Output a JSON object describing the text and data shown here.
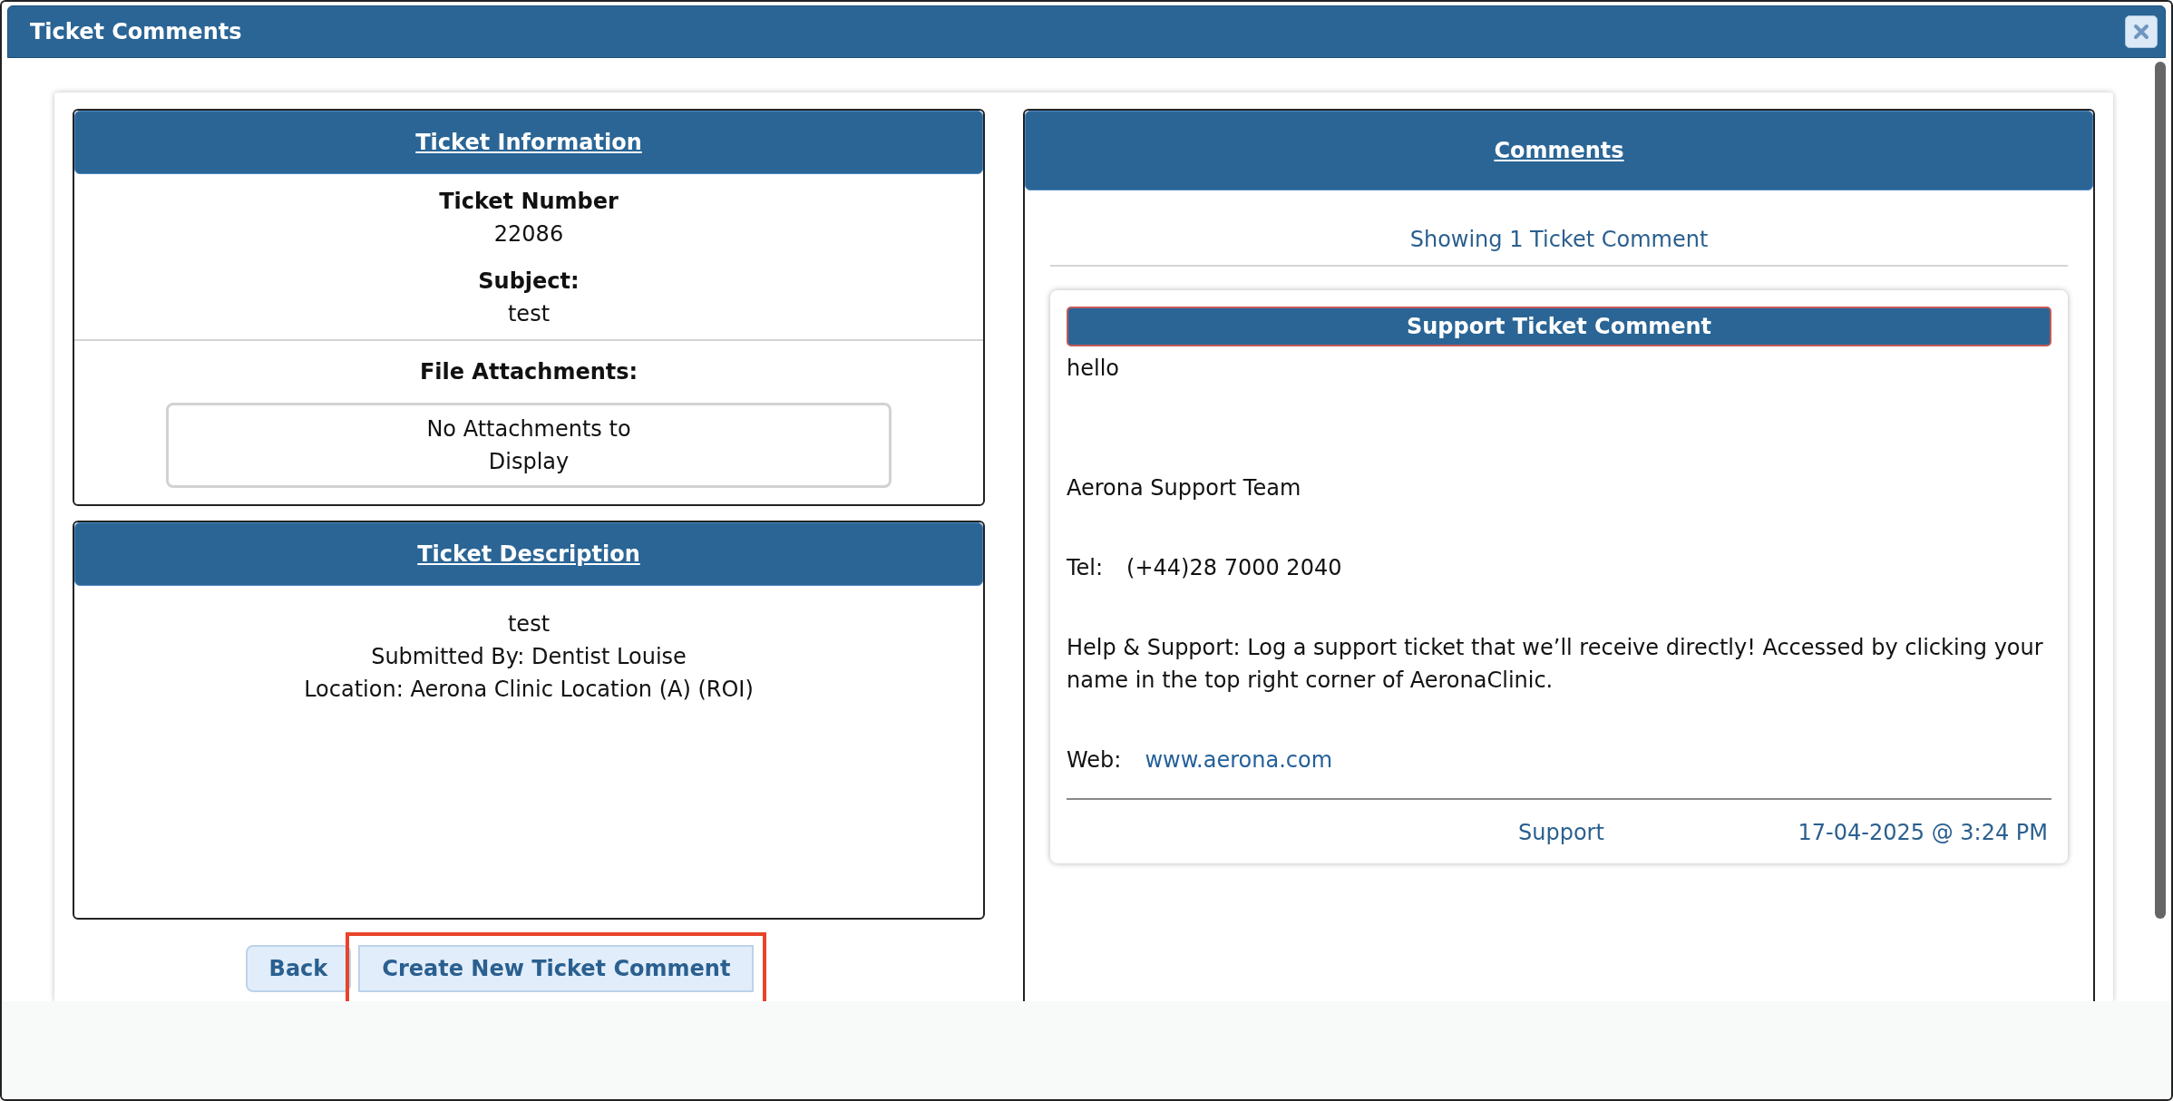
{
  "window": {
    "title": "Ticket Comments"
  },
  "ticket_information": {
    "heading": "Ticket Information",
    "fields": [
      {
        "label": "Ticket Number",
        "value": "22086"
      },
      {
        "label": "Subject:",
        "value": "test"
      }
    ],
    "attachments_label": "File Attachments:",
    "attachments_empty": "No Attachments to Display"
  },
  "ticket_description": {
    "heading": "Ticket Description",
    "lines": [
      "test",
      "Submitted By: Dentist Louise",
      "Location: Aerona Clinic Location (A) (ROI)"
    ]
  },
  "buttons": [
    {
      "label": "Back",
      "highlighted": false
    },
    {
      "label": "Create New Ticket Comment",
      "highlighted": true
    }
  ],
  "comments": {
    "heading": "Comments",
    "summary": "Showing 1 Ticket Comment",
    "items": [
      {
        "title": "Support Ticket Comment",
        "blocks": [
          {
            "kind": "text",
            "text": "hello"
          },
          {
            "kind": "text",
            "text": "Aerona Support Team"
          },
          {
            "kind": "field",
            "label": "Tel:",
            "value": "(+44)28 7000 2040"
          },
          {
            "kind": "text",
            "text": "Help & Support: Log a support ticket that we’ll receive directly! Accessed by clicking your name in the top right corner of AeronaClinic."
          },
          {
            "kind": "link",
            "label": "Web:",
            "value": "www.aerona.com"
          }
        ],
        "author": "Support",
        "timestamp": "17-04-2025 @ 3:24 PM"
      }
    ]
  }
}
